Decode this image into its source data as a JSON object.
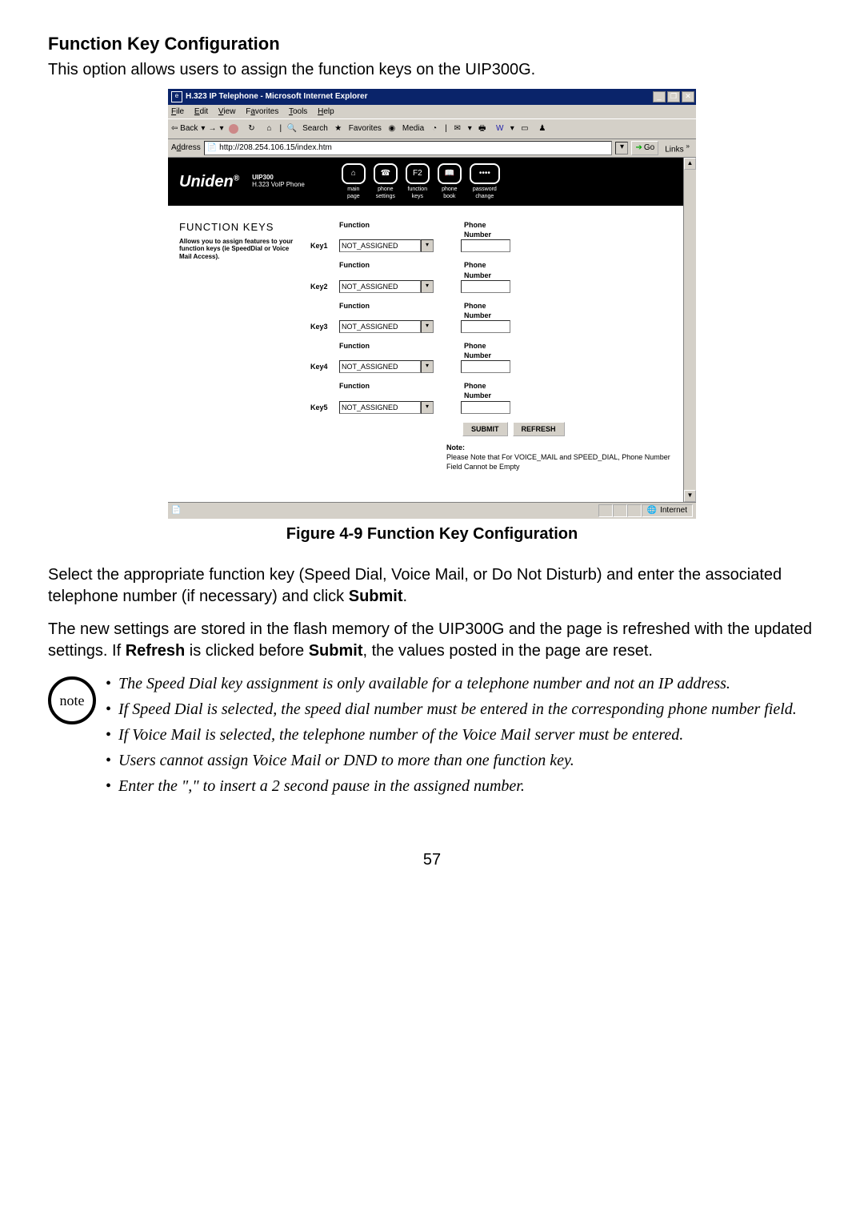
{
  "heading": "Function Key Configuration",
  "intro": "This option allows users to assign the function keys on the UIP300G.",
  "figure_caption": "Figure 4-9 Function Key Configuration",
  "para1_a": "Select the appropriate function key (Speed Dial, Voice Mail, or Do Not Disturb) and enter the associated telephone number (if necessary) and click ",
  "para1_b": "Submit",
  "para1_c": ".",
  "para2_a": "The new settings are stored in the flash memory of the UIP300G and the page is refreshed with the updated settings. If ",
  "para2_b": "Refresh",
  "para2_c": " is clicked before ",
  "para2_d": "Submit",
  "para2_e": ", the values posted in the page are reset.",
  "note_label": "note",
  "notes": {
    "0": "The Speed Dial key assignment is only available for a telephone number and not an IP address.",
    "1": "If Speed Dial is selected, the speed dial number must be entered in the corresponding phone number field.",
    "2": "If Voice Mail is selected, the telephone number of the Voice Mail server must be entered.",
    "3": "Users cannot assign Voice Mail or DND to more than one function key.",
    "4": "Enter the \",\" to insert a 2 second pause in the assigned number."
  },
  "page_number": "57",
  "browser": {
    "title": "H.323 IP Telephone - Microsoft Internet Explorer",
    "menu": {
      "file": "File",
      "edit": "Edit",
      "view": "View",
      "fav": "Favorites",
      "tools": "Tools",
      "help": "Help"
    },
    "toolbar": {
      "back": "Back",
      "search": "Search",
      "favorites": "Favorites",
      "media": "Media"
    },
    "address_label": "Address",
    "address_value": "http://208.254.106.15/index.htm",
    "go": "Go",
    "links": "Links",
    "status_zone": "Internet",
    "win": {
      "min": "_",
      "max": "❐",
      "close": "✕"
    }
  },
  "uniden": {
    "brand": "Uniden",
    "model": "UIP300",
    "sub": "H.323 VoIP Phone",
    "nav": {
      "main": "main\npage",
      "phone": "phone\nsettings",
      "func": "function\nkeys",
      "book": "phone\nbook",
      "pwd": "password\nchange"
    }
  },
  "fk": {
    "title": "FUNCTION KEYS",
    "desc": "Allows you to assign features to your function keys (ie SpeedDial or Voice Mail Access).",
    "hdr_func": "Function",
    "hdr_phone": "Phone\nNumber",
    "rows": {
      "0": {
        "label": "Key1",
        "value": "NOT_ASSIGNED"
      },
      "1": {
        "label": "Key2",
        "value": "NOT_ASSIGNED"
      },
      "2": {
        "label": "Key3",
        "value": "NOT_ASSIGNED"
      },
      "3": {
        "label": "Key4",
        "value": "NOT_ASSIGNED"
      },
      "4": {
        "label": "Key5",
        "value": "NOT_ASSIGNED"
      }
    },
    "submit": "SUBMIT",
    "refresh": "REFRESH",
    "note_h": "Note:",
    "note_body": "Please Note that For VOICE_MAIL and SPEED_DIAL, Phone Number Field Cannot be Empty"
  }
}
